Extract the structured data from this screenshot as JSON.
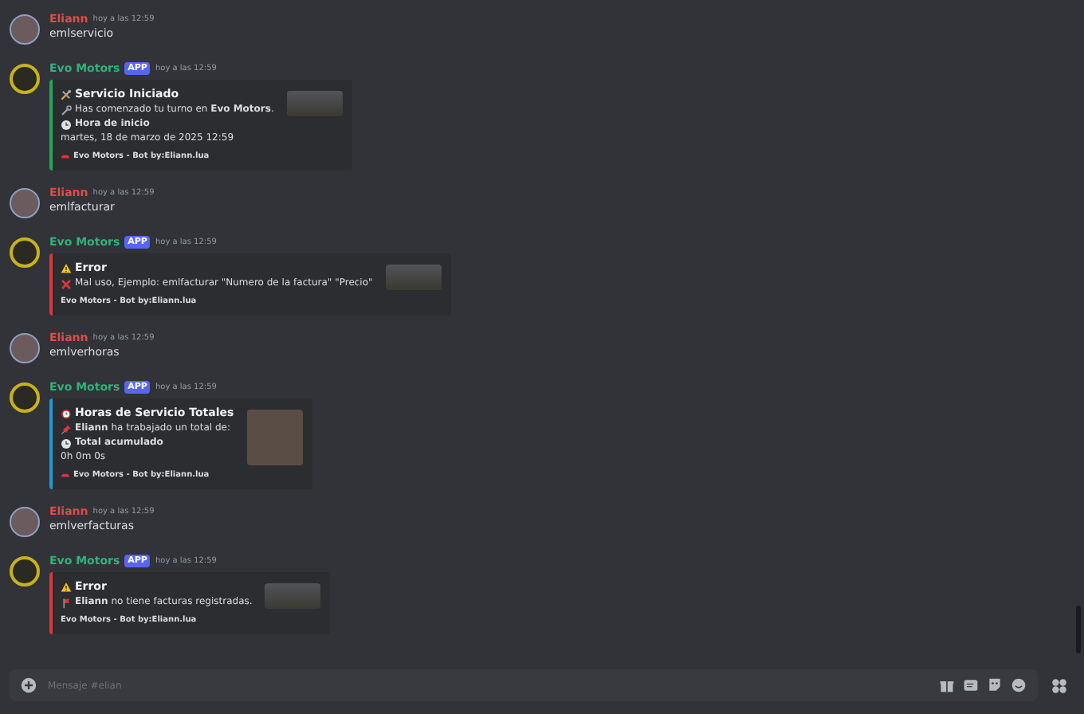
{
  "messages": [
    {
      "kind": "user",
      "author": "Eliann",
      "time": "hoy a las 12:59",
      "text": "emlservicio"
    },
    {
      "kind": "bot",
      "author": "Evo Motors",
      "badge": "APP",
      "time": "hoy a las 12:59",
      "embed": {
        "color": "#23a55a",
        "lines": [
          {
            "kind": "title",
            "text": "Servicio Iniciado"
          },
          {
            "kind": "text",
            "text": "Has comenzado tu turno en **Evo Motors**."
          },
          {
            "kind": "field",
            "text": "Hora de inicio"
          },
          {
            "kind": "value",
            "text": "martes, 18 de marzo de 2025 12:59"
          },
          {
            "kind": "footer",
            "text": "Evo Motors - Bot by:Eliann.lua"
          }
        ]
      }
    },
    {
      "kind": "user",
      "author": "Eliann",
      "time": "hoy a las 12:59",
      "text": "emlfacturar"
    },
    {
      "kind": "bot",
      "author": "Evo Motors",
      "badge": "APP",
      "time": "hoy a las 12:59",
      "embed": {
        "color": "#da373c",
        "lines": [
          {
            "kind": "title",
            "text": "Error"
          },
          {
            "kind": "text",
            "text": "Mal uso, Ejemplo: emlfacturar \"Numero de la factura\" \"Precio\""
          },
          {
            "kind": "footer",
            "text": "Evo Motors - Bot by:Eliann.lua"
          }
        ]
      }
    },
    {
      "kind": "user",
      "author": "Eliann",
      "time": "hoy a las 12:59",
      "text": "emlverhoras"
    },
    {
      "kind": "bot",
      "author": "Evo Motors",
      "badge": "APP",
      "time": "hoy a las 12:59",
      "embed": {
        "color": "#1e9bd7",
        "lines": [
          {
            "kind": "title",
            "text": "Horas de Servicio Totales"
          },
          {
            "kind": "text",
            "text": "**Eliann** ha trabajado un total de:"
          },
          {
            "kind": "field",
            "text": "Total acumulado"
          },
          {
            "kind": "value",
            "text": "0h 0m 0s"
          },
          {
            "kind": "footer",
            "text": "Evo Motors - Bot by:Eliann.lua"
          }
        ]
      }
    },
    {
      "kind": "user",
      "author": "Eliann",
      "time": "hoy a las 12:59",
      "text": "emlverfacturas"
    },
    {
      "kind": "bot",
      "author": "Evo Motors",
      "badge": "APP",
      "time": "hoy a las 12:59",
      "embed": {
        "color": "#da373c",
        "lines": [
          {
            "kind": "title",
            "text": "Error"
          },
          {
            "kind": "text",
            "text": "**Eliann** no tiene facturas registradas."
          },
          {
            "kind": "footer",
            "text": "Evo Motors - Bot by:Eliann.lua"
          }
        ]
      }
    }
  ],
  "composer": {
    "placeholder": "Mensaje #elian"
  }
}
